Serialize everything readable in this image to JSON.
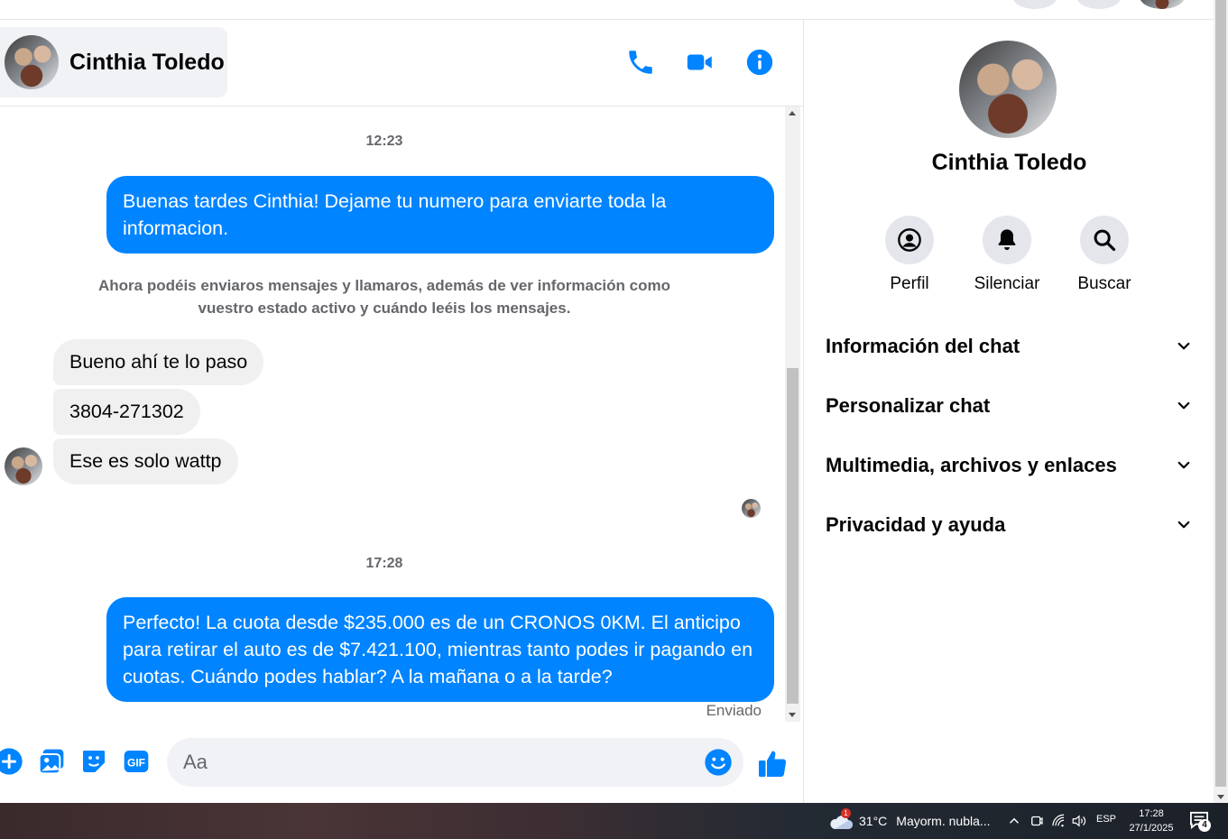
{
  "colors": {
    "accent": "#0084ff",
    "incoming_bubble": "#f0f0f0",
    "secondary_text": "#65676b"
  },
  "header": {
    "contact_name": "Cinthia Toledo",
    "icons": [
      "phone-icon",
      "video-camera-icon",
      "info-icon"
    ]
  },
  "conversation": {
    "timestamp_1": "12:23",
    "outgoing_1": "Buenas tardes Cinthia! Dejame tu numero para enviarte toda la informacion.",
    "system_note": "Ahora podéis enviaros mensajes y llamaros, además de ver información como vuestro estado activo y cuándo leéis los mensajes.",
    "incoming": [
      {
        "text": "Bueno ahí te lo paso"
      },
      {
        "text": "3804-271302"
      },
      {
        "text": "Ese es solo wattp"
      }
    ],
    "timestamp_2": "17:28",
    "outgoing_2": "Perfecto! La cuota desde $235.000 es de un CRONOS 0KM. El anticipo para retirar el auto es de $7.421.100, mientras tanto podes ir pagando en cuotas. Cuándo podes hablar? A la mañana o a la tarde?",
    "status": "Enviado"
  },
  "composer": {
    "placeholder": "Aa",
    "icons": [
      "plus-icon",
      "image-icon",
      "sticker-icon",
      "gif-icon",
      "emoji-icon",
      "thumbs-up-icon"
    ],
    "gif_label": "GIF"
  },
  "panel": {
    "name": "Cinthia Toledo",
    "actions": [
      {
        "label": "Perfil",
        "icon": "profile-icon"
      },
      {
        "label": "Silenciar",
        "icon": "bell-icon"
      },
      {
        "label": "Buscar",
        "icon": "search-icon"
      }
    ],
    "sections": [
      {
        "title": "Información del chat"
      },
      {
        "title": "Personalizar chat"
      },
      {
        "title": "Multimedia, archivos y enlaces"
      },
      {
        "title": "Privacidad y ayuda"
      }
    ]
  },
  "taskbar": {
    "weather_alert": "1",
    "temperature": "31°C",
    "weather_text": "Mayorm. nubla...",
    "language": "ESP",
    "time": "17:28",
    "date": "27/1/2025",
    "notification_count": "4"
  }
}
